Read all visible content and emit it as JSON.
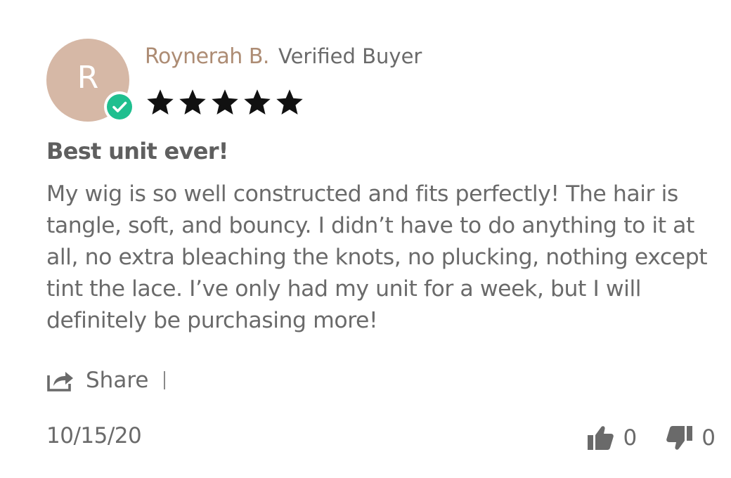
{
  "reviewer": {
    "initial": "R",
    "name": "Roynerah B.",
    "verified_label": "Verified Buyer",
    "avatar_color": "#d6b8a6",
    "name_color": "#ad8c74",
    "badge_color": "#1fbf8f"
  },
  "rating": {
    "stars": 5,
    "max_stars": 5,
    "icon": "star-icon"
  },
  "review": {
    "title": "Best unit ever!",
    "body": "My wig is so well constructed and fits perfectly! The hair is tangle, soft, and bouncy. I didn’t have to do anything to it at all, no extra bleaching the knots, no plucking, nothing except tint the lace. I’ve only had my unit for a week, but I will definitely be purchasing more!",
    "date": "10/15/20"
  },
  "actions": {
    "share_label": "Share",
    "share_icon": "share-icon",
    "thumbs_up_icon": "thumbs-up-icon",
    "thumbs_down_icon": "thumbs-down-icon",
    "thumbs_up_count": "0",
    "thumbs_down_count": "0"
  }
}
